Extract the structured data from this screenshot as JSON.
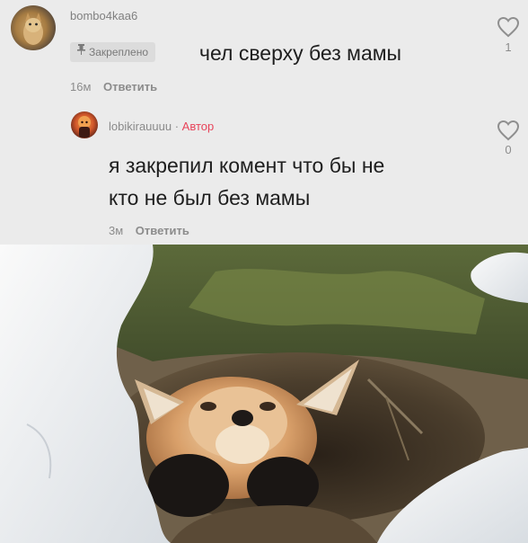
{
  "comments": [
    {
      "username": "bombo4kaa6",
      "pinned_label": "Закреплено",
      "text": "чел сверху без мамы",
      "time": "16м",
      "reply_label": "Ответить",
      "likes": "1"
    },
    {
      "username": "lobikirauuuu",
      "separator": " · ",
      "author_badge": "Автор",
      "text_line1": "я закрепил комент что бы не",
      "text_line2": "кто не был без мамы",
      "time": "3м",
      "reply_label": "Ответить",
      "likes": "0"
    }
  ],
  "icons": {
    "like": "heart-outline-icon",
    "pin": "pin-icon"
  },
  "colors": {
    "author": "#e8445a",
    "background": "#ebebeb"
  }
}
